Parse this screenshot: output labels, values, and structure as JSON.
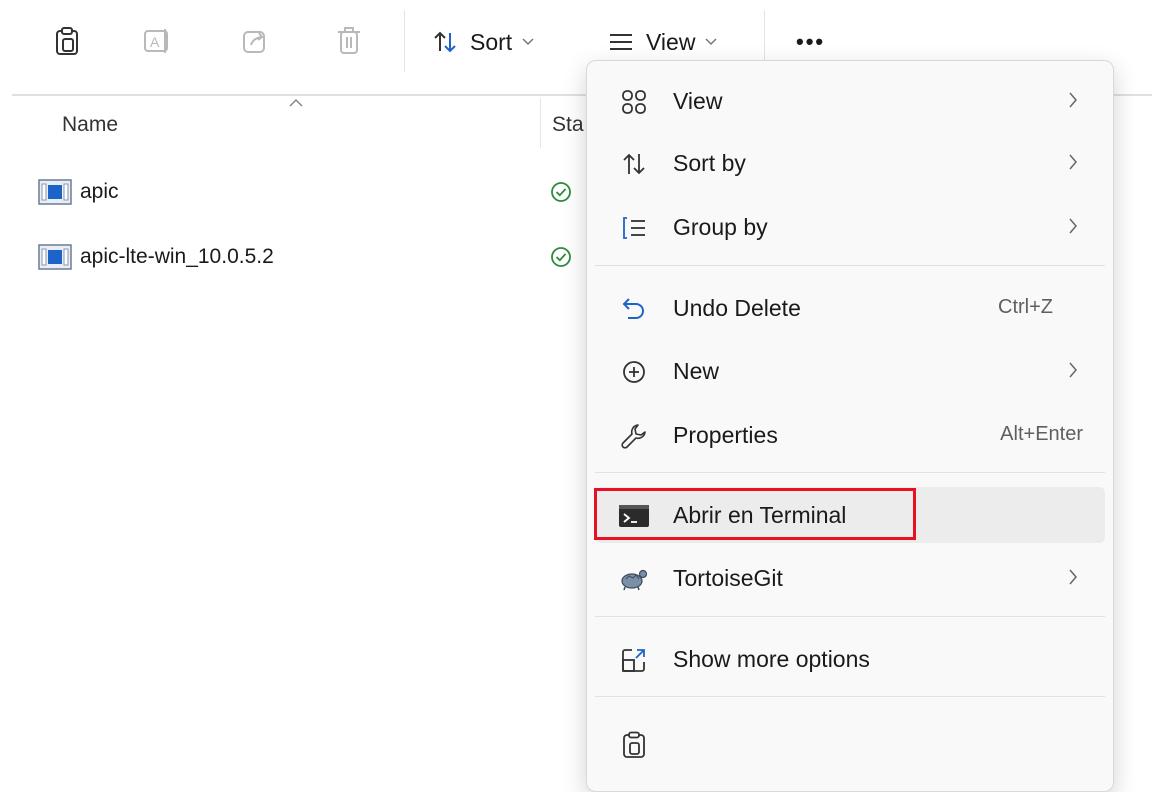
{
  "toolbar": {
    "icons": [
      "clipboard-icon",
      "rename-icon",
      "share-icon",
      "delete-icon"
    ],
    "sort_label": "Sort",
    "view_label": "View",
    "more_label": "•••"
  },
  "columns": {
    "name": "Name",
    "status": "Sta"
  },
  "files": [
    {
      "name": "apic",
      "status": "synced"
    },
    {
      "name": "apic-lte-win_10.0.5.2",
      "status": "synced"
    }
  ],
  "context_menu": {
    "items": [
      {
        "label": "View",
        "icon": "view-grid-icon",
        "submenu": true
      },
      {
        "label": "Sort by",
        "icon": "sort-icon",
        "submenu": true
      },
      {
        "label": "Group by",
        "icon": "group-icon",
        "submenu": true
      },
      {
        "label": "Undo Delete",
        "icon": "undo-icon",
        "shortcut": "Ctrl+Z"
      },
      {
        "label": "New",
        "icon": "new-icon",
        "submenu": true
      },
      {
        "label": "Properties",
        "icon": "wrench-icon",
        "shortcut": "Alt+Enter"
      },
      {
        "label": "Abrir en Terminal",
        "icon": "terminal-icon",
        "highlighted": true
      },
      {
        "label": "TortoiseGit",
        "icon": "tortoise-icon",
        "submenu": true
      },
      {
        "label": "Show more options",
        "icon": "show-more-icon"
      }
    ],
    "bottom_icon": "clipboard-icon"
  },
  "colors": {
    "highlight_box": "#e81123",
    "status_green": "#2e8b3a",
    "file_icon_blue": "#1d63c9"
  }
}
